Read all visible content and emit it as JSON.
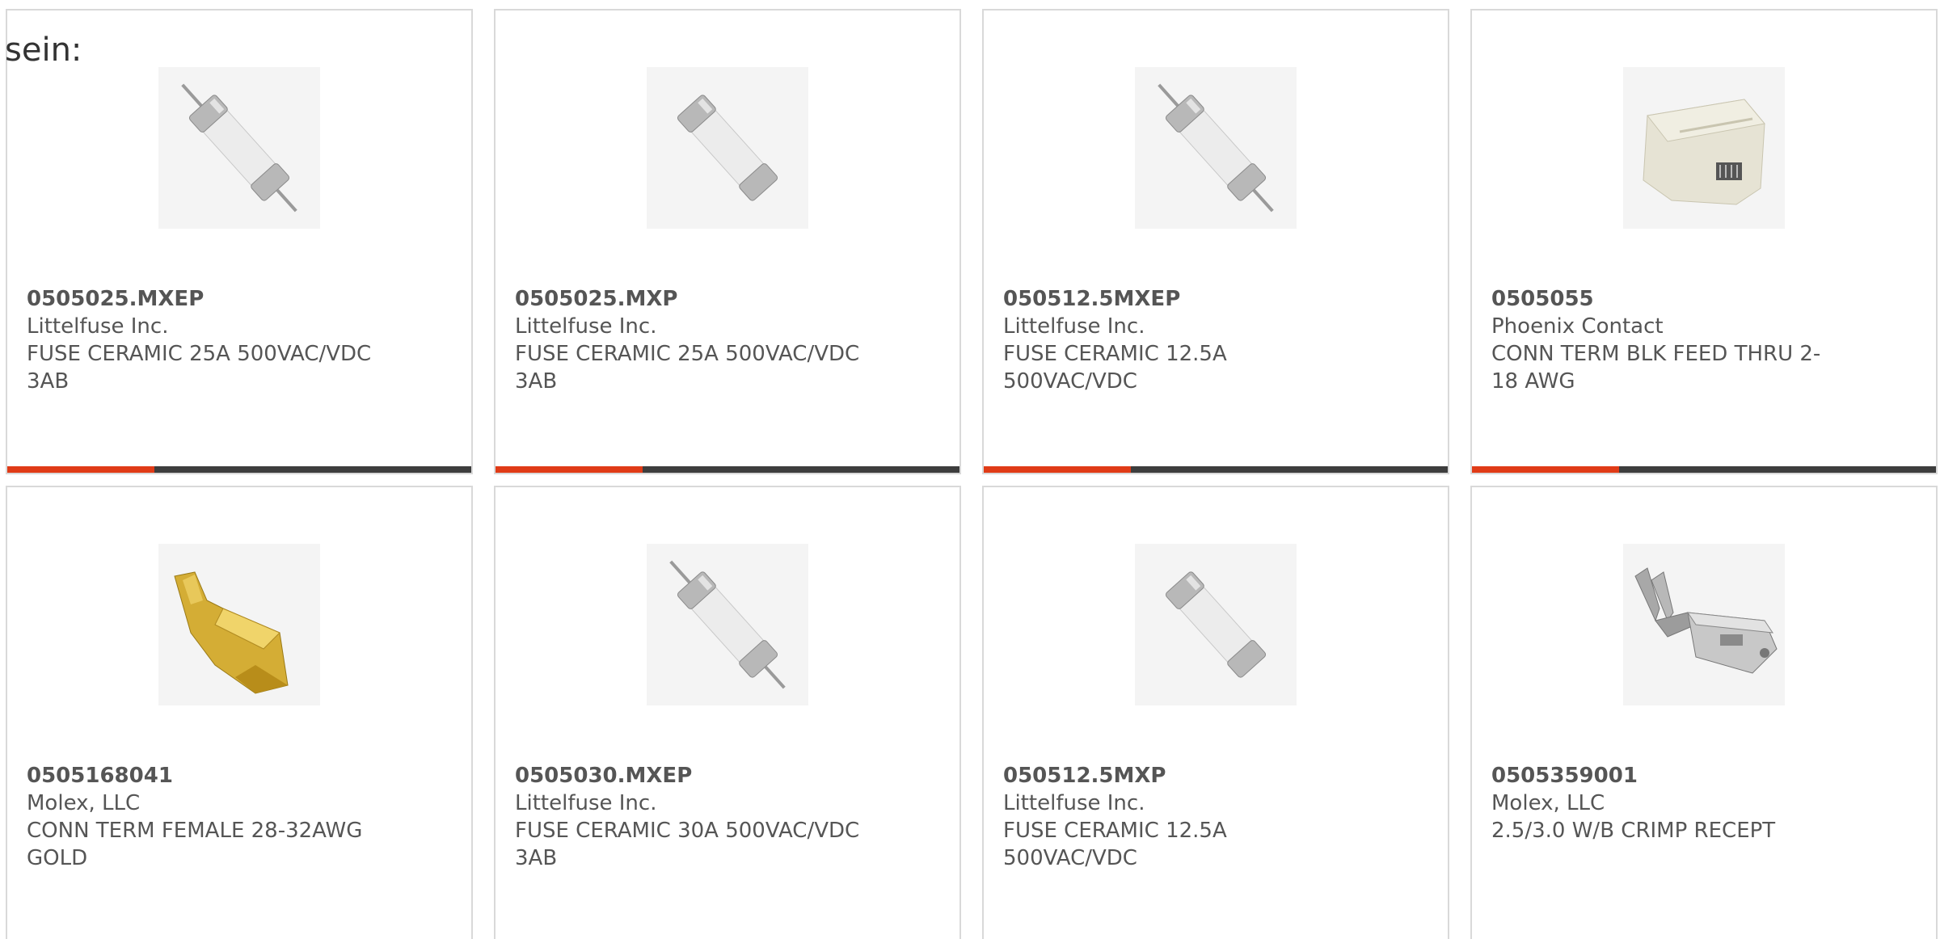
{
  "lead_text": "sein:",
  "colors": {
    "accent": "#e03b17",
    "bar": "#3d3d3d",
    "border": "#d9d9d9",
    "text": "#555555"
  },
  "products": [
    {
      "part_number": "0505025.MXEP",
      "manufacturer": "Littelfuse Inc.",
      "description": "FUSE CERAMIC 25A 500VAC/VDC 3AB",
      "image": "fuse-axial-icon"
    },
    {
      "part_number": "0505025.MXP",
      "manufacturer": "Littelfuse Inc.",
      "description": "FUSE CERAMIC 25A 500VAC/VDC 3AB",
      "image": "fuse-cartridge-icon"
    },
    {
      "part_number": "050512.5MXEP",
      "manufacturer": "Littelfuse Inc.",
      "description": "FUSE CERAMIC 12.5A 500VAC/VDC",
      "image": "fuse-axial-icon"
    },
    {
      "part_number": "0505055",
      "manufacturer": "Phoenix Contact",
      "description": "CONN TERM BLK FEED THRU 2-18 AWG",
      "image": "terminal-block-icon"
    },
    {
      "part_number": "0505168041",
      "manufacturer": "Molex, LLC",
      "description": "CONN TERM FEMALE 28-32AWG GOLD",
      "image": "gold-crimp-terminal-icon"
    },
    {
      "part_number": "0505030.MXEP",
      "manufacturer": "Littelfuse Inc.",
      "description": "FUSE CERAMIC 30A 500VAC/VDC 3AB",
      "image": "fuse-axial-icon"
    },
    {
      "part_number": "050512.5MXP",
      "manufacturer": "Littelfuse Inc.",
      "description": "FUSE CERAMIC 12.5A 500VAC/VDC",
      "image": "fuse-cartridge-icon"
    },
    {
      "part_number": "0505359001",
      "manufacturer": "Molex, LLC",
      "description": "2.5/3.0 W/B CRIMP RECEPT",
      "image": "crimp-receptacle-icon"
    }
  ]
}
